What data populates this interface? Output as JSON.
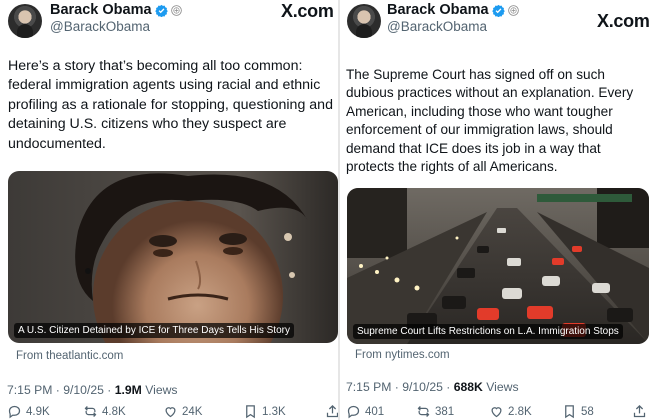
{
  "left_tweet": {
    "author": {
      "name": "Barack Obama",
      "handle": "@BarackObama"
    },
    "site_label": "X.com",
    "text": "Here’s a story that’s becoming all too common: federal immigration agents using racial and ethnic profiling as a rationale for stopping, questioning and detaining U.S. citizens who they suspect are undocumented.",
    "card": {
      "caption": "A U.S. Citizen Detained by ICE for Three Days Tells His Story",
      "source": "From theatlantic.com"
    },
    "timestamp": "7:15 PM · 9/10/25 ·",
    "views_count": "1.9M",
    "views_label": "Views",
    "actions": {
      "replies": "4.9K",
      "reposts": "4.8K",
      "likes": "24K",
      "bookmarks": "1.3K"
    }
  },
  "right_tweet": {
    "author": {
      "name": "Barack Obama",
      "handle": "@BarackObama"
    },
    "site_label": "X.com",
    "text": "The Supreme Court has signed off on such dubious practices without an explanation. Every American, including those who want tougher enforcement of our immigration laws, should demand that ICE does its job in a way that protects the rights of all Americans.",
    "card": {
      "caption": "Supreme Court Lifts Restrictions on L.A. Immigration Stops",
      "source": "From nytimes.com"
    },
    "timestamp": "7:15 PM · 9/10/25 ·",
    "views_count": "688K",
    "views_label": "Views",
    "actions": {
      "replies": "401",
      "reposts": "381",
      "likes": "2.8K",
      "bookmarks": "58"
    }
  },
  "colors": {
    "text_primary": "#0f1419",
    "text_secondary": "#536471",
    "verified_blue": "#1d9bf0"
  },
  "icons": [
    "verified-badge-icon",
    "presidential-seal-icon",
    "reply-icon",
    "repost-icon",
    "like-icon",
    "bookmark-icon",
    "share-icon"
  ]
}
